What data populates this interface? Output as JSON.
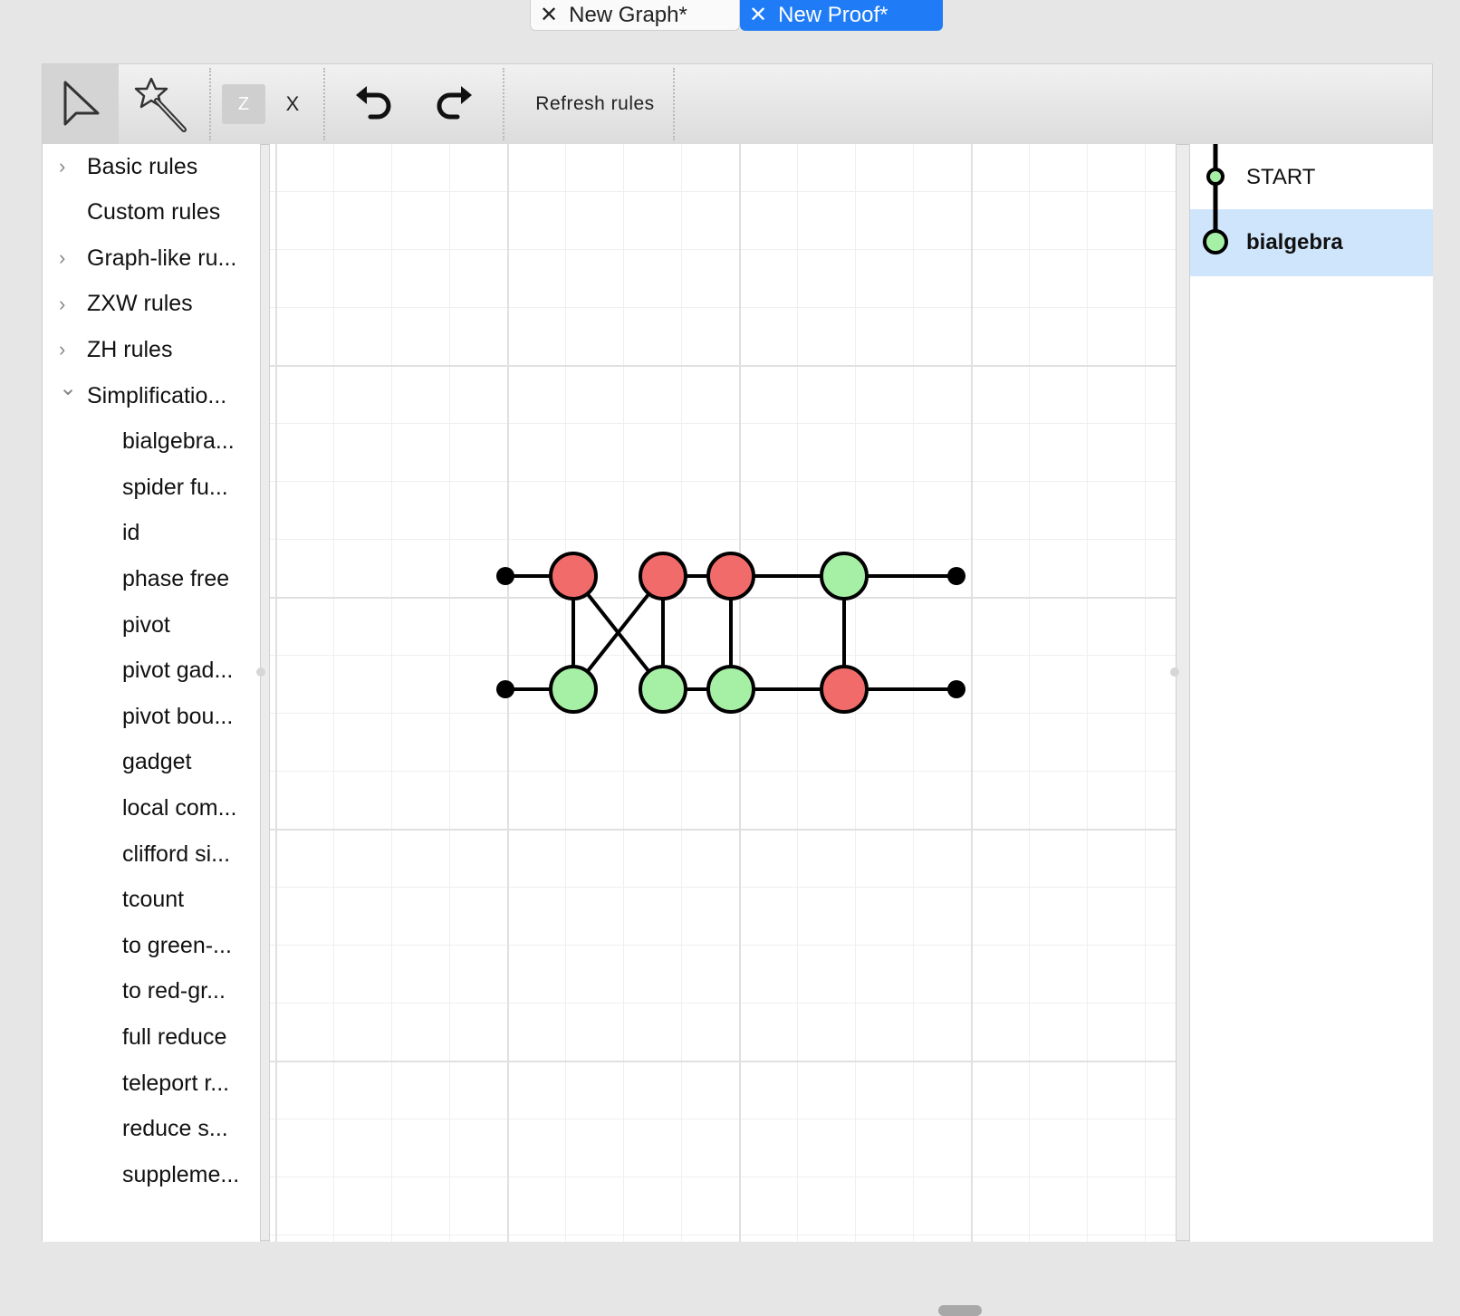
{
  "tabs": [
    {
      "label": "New Graph*",
      "active": false
    },
    {
      "label": "New Proof*",
      "active": true
    }
  ],
  "toolbar": {
    "select_icon": "pointer-arrow-icon",
    "magic_icon": "magic-wand-icon",
    "z_label": "Z",
    "x_label": "X",
    "undo_icon": "undo-icon",
    "redo_icon": "redo-icon",
    "refresh_label": "Refresh rules"
  },
  "rules_panel": {
    "groups": [
      {
        "label": "Basic rules",
        "expandable": true
      },
      {
        "label": "Custom rules",
        "expandable": false
      },
      {
        "label": "Graph-like ru...",
        "expandable": true
      },
      {
        "label": "ZXW rules",
        "expandable": true
      },
      {
        "label": "ZH rules",
        "expandable": true
      },
      {
        "label": "Simplificatio...",
        "expandable": true,
        "expanded": true
      }
    ],
    "children": [
      "bialgebra...",
      "spider fu...",
      "id",
      "phase free",
      "pivot",
      "pivot gad...",
      "pivot bou...",
      "gadget",
      "local com...",
      "clifford si...",
      "tcount",
      "to green-...",
      "to red-gr...",
      "full reduce",
      "teleport r...",
      "reduce s...",
      "suppleme..."
    ]
  },
  "graph": {
    "colors": {
      "z": "#a6f0a6",
      "x": "#f26b6b",
      "boundary": "#000000",
      "edge": "#000000"
    },
    "vertices": [
      {
        "id": "b0",
        "type": "boundary"
      },
      {
        "id": "b1",
        "type": "boundary"
      },
      {
        "id": "v1",
        "type": "x"
      },
      {
        "id": "v2",
        "type": "z"
      },
      {
        "id": "v3",
        "type": "x"
      },
      {
        "id": "v4",
        "type": "z"
      },
      {
        "id": "v5",
        "type": "x"
      },
      {
        "id": "v6",
        "type": "z"
      },
      {
        "id": "v7",
        "type": "z"
      },
      {
        "id": "v8",
        "type": "x"
      },
      {
        "id": "b2",
        "type": "boundary"
      },
      {
        "id": "b3",
        "type": "boundary"
      }
    ],
    "edges": [
      [
        "b0",
        "v1"
      ],
      [
        "b1",
        "v2"
      ],
      [
        "v1",
        "v2"
      ],
      [
        "v1",
        "v4"
      ],
      [
        "v2",
        "v3"
      ],
      [
        "v3",
        "v4"
      ],
      [
        "v3",
        "v5"
      ],
      [
        "v4",
        "v6"
      ],
      [
        "v5",
        "v6"
      ],
      [
        "v5",
        "v7"
      ],
      [
        "v6",
        "v8"
      ],
      [
        "v7",
        "v8"
      ],
      [
        "v7",
        "b2"
      ],
      [
        "v8",
        "b3"
      ]
    ]
  },
  "proof_steps": [
    {
      "label": "START",
      "selected": false
    },
    {
      "label": "bialgebra",
      "selected": true
    }
  ]
}
